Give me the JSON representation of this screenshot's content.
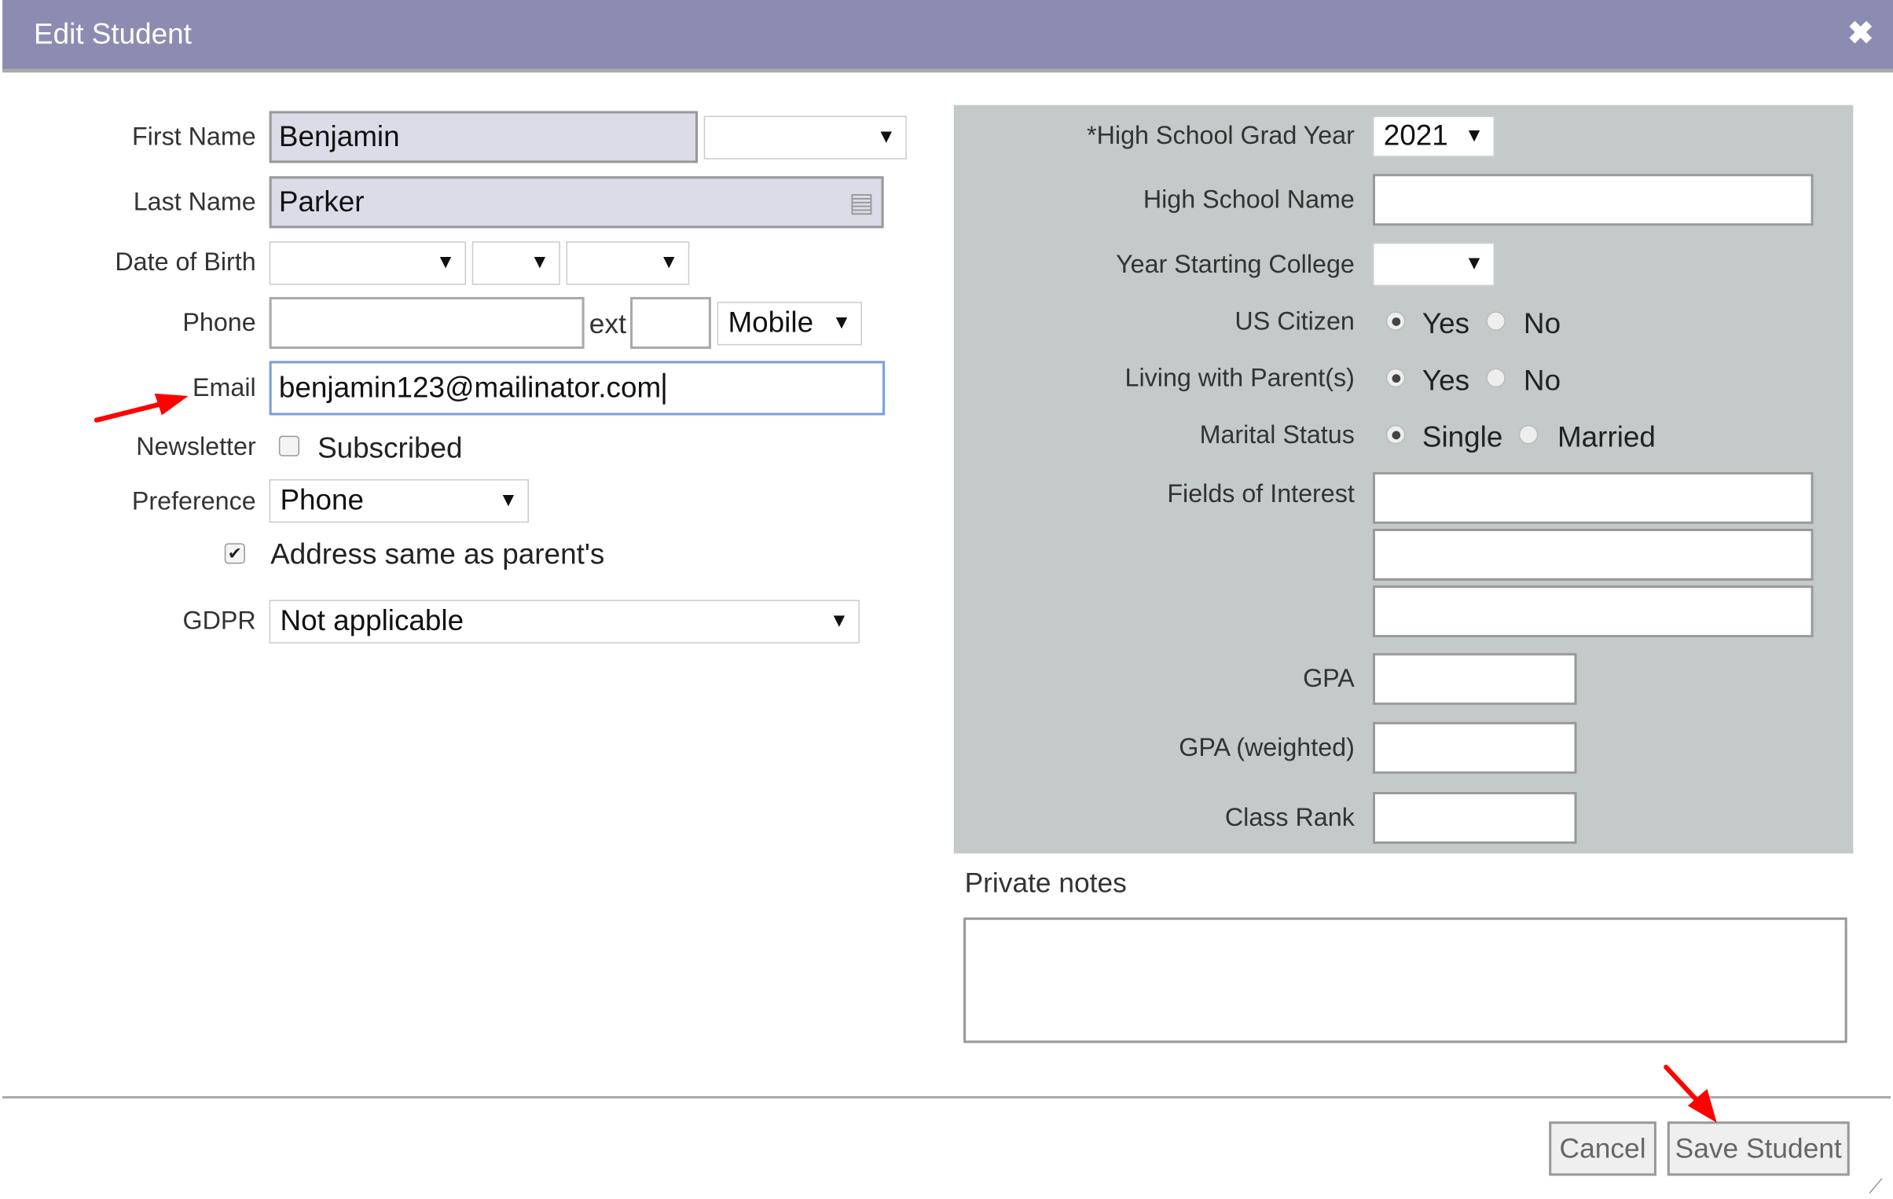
{
  "dialog": {
    "title": "Edit Student",
    "close_icon": "close-icon"
  },
  "left": {
    "first_name": {
      "label": "First Name",
      "value": "Benjamin",
      "suffix_value": ""
    },
    "last_name": {
      "label": "Last Name",
      "value": "Parker"
    },
    "dob": {
      "label": "Date of Birth",
      "month": "",
      "day": "",
      "year": ""
    },
    "phone": {
      "label": "Phone",
      "value": "",
      "ext_label": "ext",
      "ext_value": "",
      "type": "Mobile"
    },
    "email": {
      "label": "Email",
      "value": "benjamin123@mailinator.com"
    },
    "newsletter": {
      "label": "Newsletter",
      "option": "Subscribed",
      "checked": false
    },
    "preference": {
      "label": "Preference",
      "value": "Phone"
    },
    "address_same": {
      "label": "Address same as parent's",
      "checked": true
    },
    "gdpr": {
      "label": "GDPR",
      "value": "Not applicable"
    }
  },
  "right": {
    "grad_year": {
      "label": "*High School Grad Year",
      "value": "2021"
    },
    "hs_name": {
      "label": "High School Name",
      "value": ""
    },
    "year_college": {
      "label": "Year Starting College",
      "value": ""
    },
    "us_citizen": {
      "label": "US Citizen",
      "yes": "Yes",
      "no": "No",
      "selected": "Yes"
    },
    "living_parents": {
      "label": "Living with Parent(s)",
      "yes": "Yes",
      "no": "No",
      "selected": "Yes"
    },
    "marital": {
      "label": "Marital Status",
      "single": "Single",
      "married": "Married",
      "selected": "Single"
    },
    "interests": {
      "label": "Fields of Interest",
      "values": [
        "",
        "",
        ""
      ]
    },
    "gpa": {
      "label": "GPA",
      "value": ""
    },
    "gpa_weighted": {
      "label": "GPA (weighted)",
      "value": ""
    },
    "class_rank": {
      "label": "Class Rank",
      "value": ""
    },
    "notes": {
      "label": "Private notes",
      "value": ""
    }
  },
  "footer": {
    "cancel": "Cancel",
    "save": "Save Student"
  },
  "colors": {
    "header": "#8c8cb3",
    "panel": "#c3cac9",
    "annotation": "#ff0000"
  }
}
